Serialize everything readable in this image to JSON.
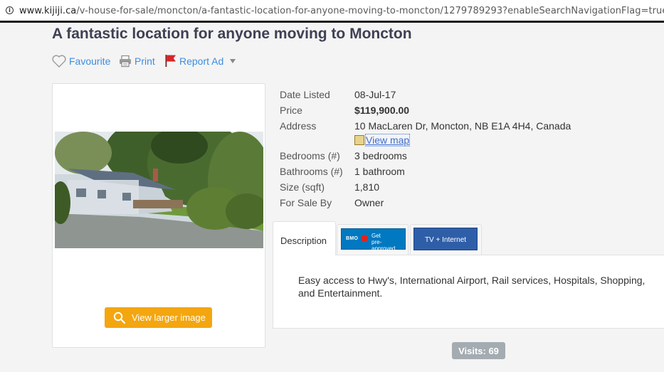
{
  "browser": {
    "url_host": "www.kijiji.ca",
    "url_path": "/v-house-for-sale/moncton/a-fantastic-location-for-anyone-moving-to-moncton/1279789293?enableSearchNavigationFlag=true"
  },
  "listing": {
    "title": "A fantastic location for anyone moving to Moncton"
  },
  "actions": {
    "favourite": "Favourite",
    "print": "Print",
    "report": "Report Ad"
  },
  "image": {
    "view_larger": "View larger image"
  },
  "details": {
    "date_listed": {
      "label": "Date Listed",
      "value": "08-Jul-17"
    },
    "price": {
      "label": "Price",
      "value": "$119,900.00"
    },
    "address": {
      "label": "Address",
      "value": "10 MacLaren Dr, Moncton, NB E1A 4H4, Canada",
      "map_link": "View map"
    },
    "bedrooms": {
      "label": "Bedrooms (#)",
      "value": "3 bedrooms"
    },
    "bathrooms": {
      "label": "Bathrooms (#)",
      "value": "1 bathroom"
    },
    "size": {
      "label": "Size (sqft)",
      "value": "1,810"
    },
    "for_sale_by": {
      "label": "For Sale By",
      "value": "Owner"
    }
  },
  "tabs": {
    "description": "Description",
    "bmo_brand": "BMO",
    "bmo_text_1": "Get",
    "bmo_text_2": "pre-approved",
    "tv_internet": "TV + Internet"
  },
  "description": {
    "text": "Easy access to Hwy's, International Airport, Rail services, Hospitals, Shopping, and Entertainment."
  },
  "visits": "Visits: 69",
  "colors": {
    "title": "#3e4153",
    "link": "#3e8ddf",
    "button": "#f3a60f",
    "visits_badge": "#a4acb2",
    "bmo_blue": "#0079c1",
    "tv_blue": "#2f5ea8"
  },
  "icons": [
    "info-icon",
    "heart-icon",
    "printer-icon",
    "flag-icon",
    "caret-down-icon",
    "magnify-icon",
    "map-icon"
  ]
}
